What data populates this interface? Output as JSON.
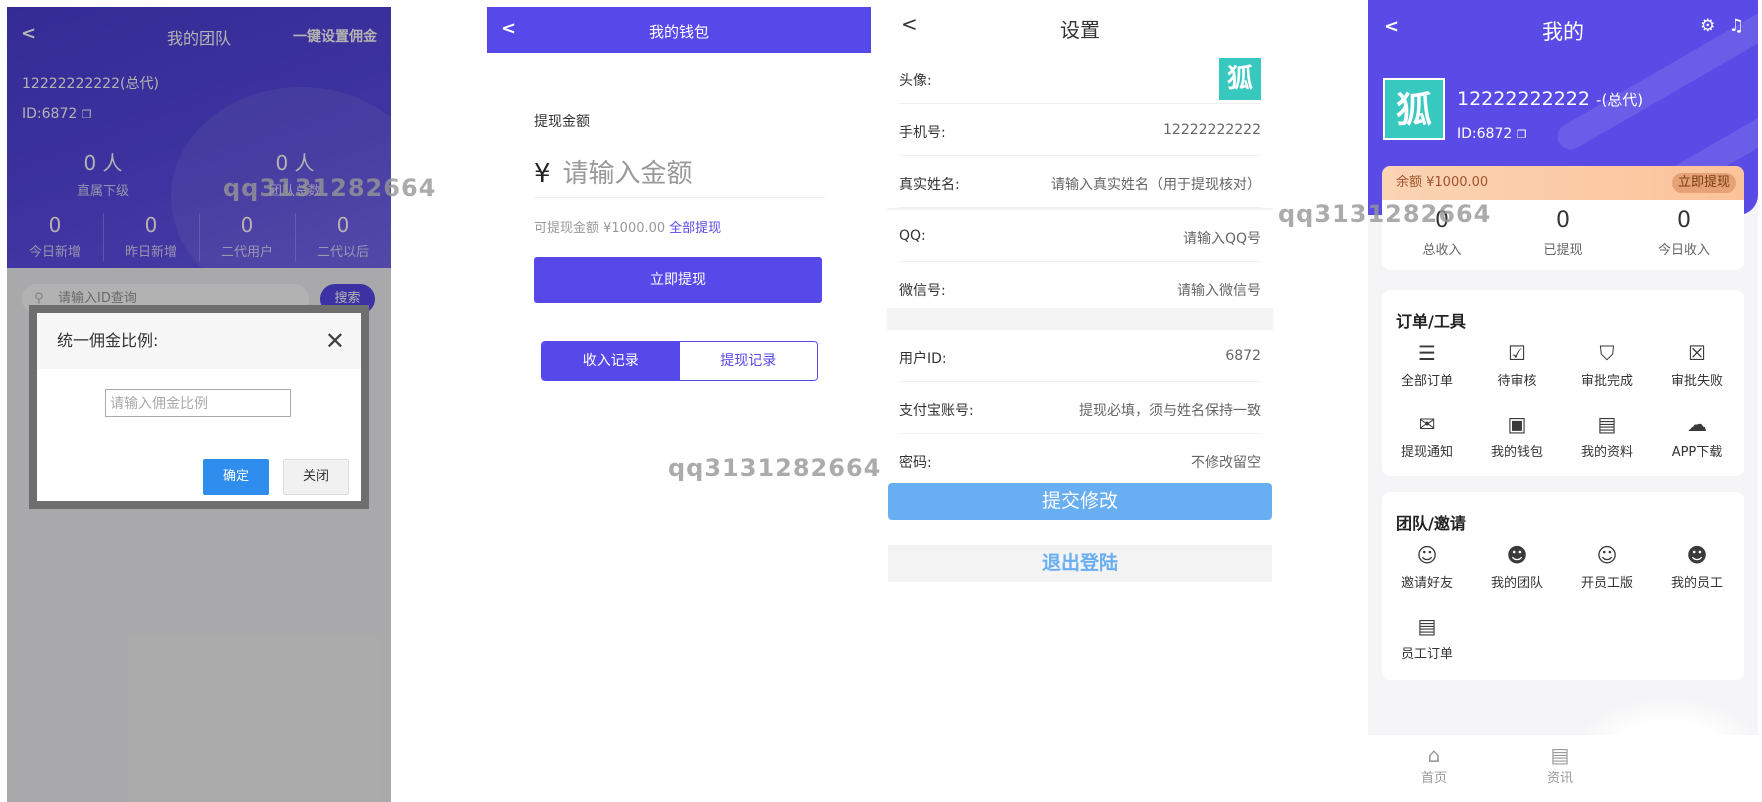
{
  "team": {
    "back": "<",
    "title": "我的团队",
    "set_all": "一键设置佣金",
    "account": "12222222222(总代)",
    "uid": "ID:6872",
    "direct": {
      "value": "0 人",
      "label": "直属下级"
    },
    "team_total": {
      "value": "0 人",
      "label": "团队总数"
    },
    "today_new": {
      "value": "0",
      "label": "今日新增"
    },
    "yesterday_new": {
      "value": "0",
      "label": "昨日新增"
    },
    "second_users": {
      "value": "0",
      "label": "二代用户"
    },
    "second_after": {
      "value": "0",
      "label": "二代以后"
    },
    "search_placeholder": "请输入ID查询",
    "search_button": "搜索",
    "dialog": {
      "title": "统一佣金比例:",
      "close_x": "✕",
      "input_placeholder": "请输入佣金比例",
      "confirm": "确定",
      "close": "关闭"
    }
  },
  "wallet": {
    "back": "<",
    "title": "我的钱包",
    "amount_label": "提现金额",
    "currency": "¥",
    "amount_placeholder": "请输入金额",
    "available": "可提现金额 ¥1000.00",
    "withdraw_all": "全部提现",
    "withdraw_button": "立即提现",
    "tab_income": "收入记录",
    "tab_withdraw": "提现记录"
  },
  "settings": {
    "back": "<",
    "title": "设置",
    "avatar_label": "头像:",
    "avatar_glyph": "狐",
    "phone_label": "手机号:",
    "phone_value": "12222222222",
    "realname_label": "真实姓名:",
    "realname_placeholder": "请输入真实姓名（用于提现核对）",
    "qq_label": "QQ:",
    "qq_placeholder": "请输入QQ号",
    "wechat_label": "微信号:",
    "wechat_placeholder": "请输入微信号",
    "userid_label": "用户ID:",
    "userid_value": "6872",
    "alipay_label": "支付宝账号:",
    "alipay_placeholder": "提现必填，须与姓名保持一致",
    "password_label": "密码:",
    "password_placeholder": "不修改留空",
    "submit": "提交修改",
    "logout": "退出登陆"
  },
  "mine": {
    "back": "<",
    "title": "我的",
    "avatar_glyph": "狐",
    "phone": "12222222222",
    "role": "-(总代)",
    "uid": "ID:6872",
    "balance": "余额 ¥1000.00",
    "withdraw_now": "立即提现",
    "total_income": {
      "value": "0",
      "label": "总收入"
    },
    "withdrawn": {
      "value": "0",
      "label": "已提现"
    },
    "today_income": {
      "value": "0",
      "label": "今日收入"
    },
    "orders_title": "订单/工具",
    "orders": [
      {
        "icon": "list-icon",
        "glyph": "☰",
        "label": "全部订单"
      },
      {
        "icon": "pending-check-icon",
        "glyph": "☑",
        "label": "待审核"
      },
      {
        "icon": "approved-icon",
        "glyph": "⛉",
        "label": "审批完成"
      },
      {
        "icon": "rejected-icon",
        "glyph": "☒",
        "label": "审批失败"
      },
      {
        "icon": "message-icon",
        "glyph": "✉",
        "label": "提现通知"
      },
      {
        "icon": "wallet-icon",
        "glyph": "▣",
        "label": "我的钱包"
      },
      {
        "icon": "document-icon",
        "glyph": "▤",
        "label": "我的资料"
      },
      {
        "icon": "download-icon",
        "glyph": "☁",
        "label": "APP下载"
      }
    ],
    "team_title": "团队/邀请",
    "team": [
      {
        "icon": "invite-icon",
        "glyph": "☺",
        "label": "邀请好友"
      },
      {
        "icon": "team-icon",
        "glyph": "☻",
        "label": "我的团队"
      },
      {
        "icon": "staff-version-icon",
        "glyph": "☺",
        "label": "开员工版"
      },
      {
        "icon": "staff-icon",
        "glyph": "☻",
        "label": "我的员工"
      },
      {
        "icon": "staff-order-icon",
        "glyph": "▤",
        "label": "员工订单"
      }
    ],
    "tab_home": "首页",
    "tab_news": "资讯"
  },
  "watermark": "qq3131282664"
}
